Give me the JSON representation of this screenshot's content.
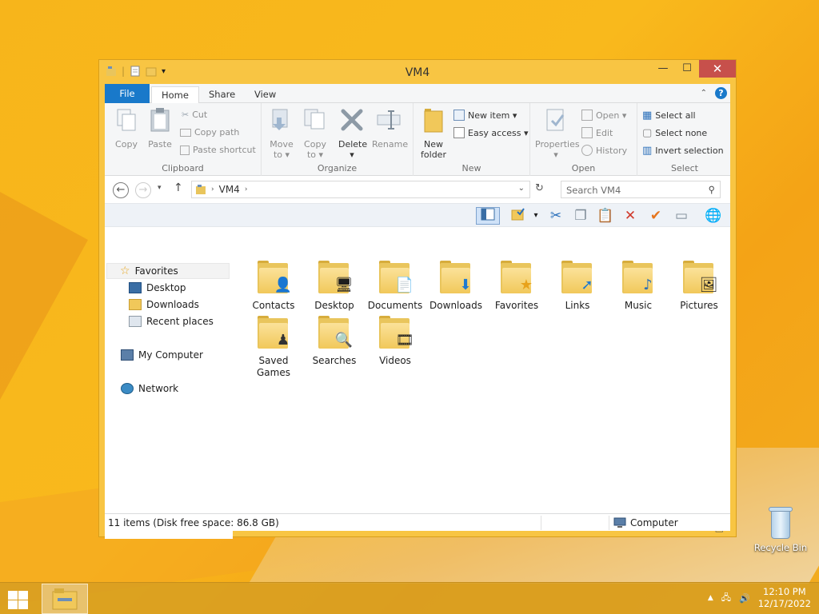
{
  "window": {
    "title": "VM4",
    "controls": {
      "minimize": "—",
      "maximize": "☐",
      "close": "✕"
    }
  },
  "tabs": {
    "file": "File",
    "home": "Home",
    "share": "Share",
    "view": "View"
  },
  "ribbon": {
    "clipboard": {
      "label": "Clipboard",
      "copy": "Copy",
      "paste": "Paste",
      "cut": "Cut",
      "copy_path": "Copy path",
      "paste_shortcut": "Paste shortcut"
    },
    "organize": {
      "label": "Organize",
      "move_to_1": "Move",
      "move_to_2": "to ▾",
      "copy_to_1": "Copy",
      "copy_to_2": "to ▾",
      "delete": "Delete",
      "delete_arrow": "▾",
      "rename": "Rename"
    },
    "new": {
      "label": "New",
      "new_folder_1": "New",
      "new_folder_2": "folder",
      "new_item": "New item ▾",
      "easy_access": "Easy access ▾"
    },
    "open": {
      "label": "Open",
      "properties": "Properties",
      "properties_arrow": "▾",
      "open": "Open ▾",
      "edit": "Edit",
      "history": "History"
    },
    "select": {
      "label": "Select",
      "select_all": "Select all",
      "select_none": "Select none",
      "invert": "Invert selection"
    }
  },
  "address": {
    "path": "VM4",
    "search_placeholder": "Search VM4"
  },
  "nav": {
    "favorites": "Favorites",
    "desktop": "Desktop",
    "downloads": "Downloads",
    "recent": "Recent places",
    "computer": "My Computer",
    "network": "Network"
  },
  "folders": [
    {
      "name": "Contacts",
      "badge": "👤"
    },
    {
      "name": "Desktop",
      "badge": "🖥"
    },
    {
      "name": "Documents",
      "badge": "📄"
    },
    {
      "name": "Downloads",
      "badge": "⬇"
    },
    {
      "name": "Favorites",
      "badge": "★"
    },
    {
      "name": "Links",
      "badge": "➚"
    },
    {
      "name": "Music",
      "badge": "♪"
    },
    {
      "name": "Pictures",
      "badge": "🖼"
    },
    {
      "name": "Saved Games",
      "badge": "♟"
    },
    {
      "name": "Searches",
      "badge": "🔍"
    },
    {
      "name": "Videos",
      "badge": "🎞"
    }
  ],
  "status": {
    "item_count": "11 items",
    "bar_left": "11 items (Disk free space: 86.8 GB)",
    "bar_right": "Computer"
  },
  "desktop": {
    "recycle_bin": "Recycle Bin"
  },
  "taskbar": {
    "time": "12:10 PM",
    "date": "12/17/2022"
  }
}
